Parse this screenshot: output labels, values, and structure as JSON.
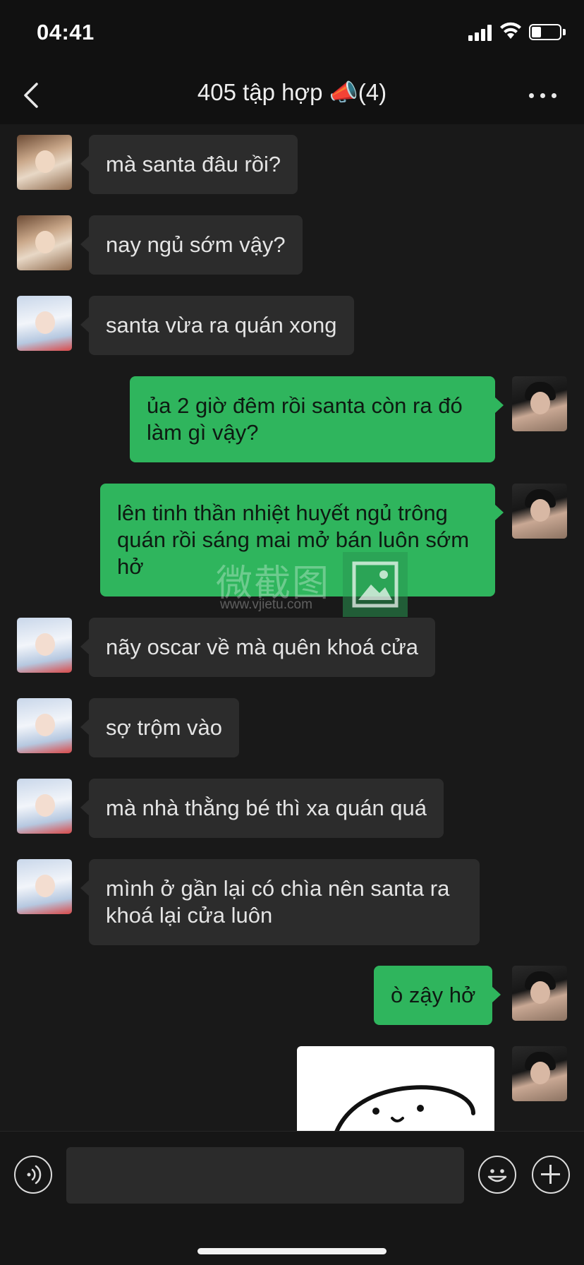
{
  "status_bar": {
    "time": "04:41",
    "battery_level": 0.3
  },
  "header": {
    "title": "405 tập hợp 📣(4)",
    "back_icon": "chevron-left-icon",
    "more_icon": "more-dots-icon"
  },
  "messages": [
    {
      "sender": "contact-a",
      "direction": "in",
      "text": "mà santa đâu rồi?"
    },
    {
      "sender": "contact-a",
      "direction": "in",
      "text": "nay ngủ sớm vậy?"
    },
    {
      "sender": "contact-b",
      "direction": "in",
      "text": "santa vừa ra quán xong"
    },
    {
      "sender": "me",
      "direction": "out",
      "text": "ủa 2 giờ đêm rồi santa còn ra đó làm gì vậy?"
    },
    {
      "sender": "me",
      "direction": "out",
      "text": "lên tinh thần nhiệt huyết ngủ trông quán rồi sáng mai mở bán luôn sớm hở"
    },
    {
      "sender": "contact-b",
      "direction": "in",
      "text": "nãy oscar về mà quên khoá cửa"
    },
    {
      "sender": "contact-b",
      "direction": "in",
      "text": "sợ trộm vào"
    },
    {
      "sender": "contact-b",
      "direction": "in",
      "text": "mà nhà thằng bé thì xa quán quá"
    },
    {
      "sender": "contact-b",
      "direction": "in",
      "text": "mình ở gần lại có chìa nên santa ra khoá lại cửa luôn"
    },
    {
      "sender": "me",
      "direction": "out",
      "text": "ò zậy hở"
    },
    {
      "sender": "me",
      "direction": "out",
      "type": "image",
      "content": "sticker-image"
    }
  ],
  "watermark": {
    "text": "微截图",
    "url": "www.vjietu.com"
  },
  "input_bar": {
    "input_value": "",
    "voice_icon": "voice-icon",
    "emoji_icon": "emoji-icon",
    "plus_icon": "plus-icon"
  },
  "colors": {
    "background": "#191919",
    "bar": "#111111",
    "incoming_bubble": "#2c2c2c",
    "outgoing_bubble": "#2fb55d"
  }
}
